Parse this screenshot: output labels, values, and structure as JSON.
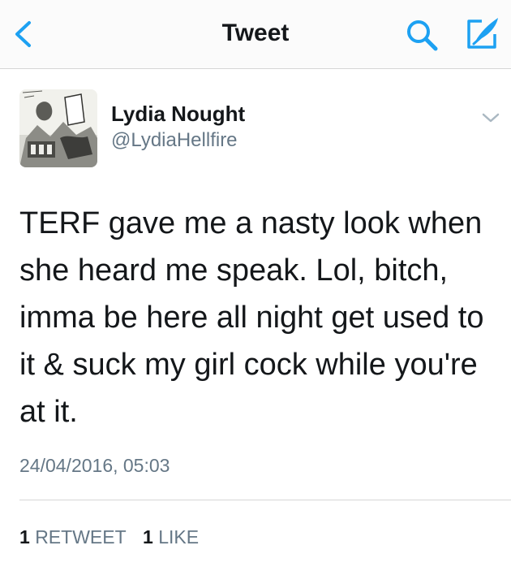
{
  "colors": {
    "accent": "#1da1f2",
    "text": "#14171a",
    "secondary": "#657786",
    "divider": "#d6d6d6"
  },
  "navbar": {
    "title": "Tweet",
    "back_icon": "chevron-left-icon",
    "search_icon": "search-icon",
    "compose_icon": "compose-feather-icon"
  },
  "tweet": {
    "author_name": "Lydia Nought",
    "author_handle": "@LydiaHellfire",
    "more_icon": "chevron-down-icon",
    "text": "TERF gave me a nasty look when she heard me speak. Lol, bitch, imma be here all night get used to it & suck my girl cock while you're at it.",
    "timestamp": "24/04/2016, 05:03",
    "retweet_count": "1",
    "retweet_label": "RETWEET",
    "like_count": "1",
    "like_label": "LIKE"
  }
}
